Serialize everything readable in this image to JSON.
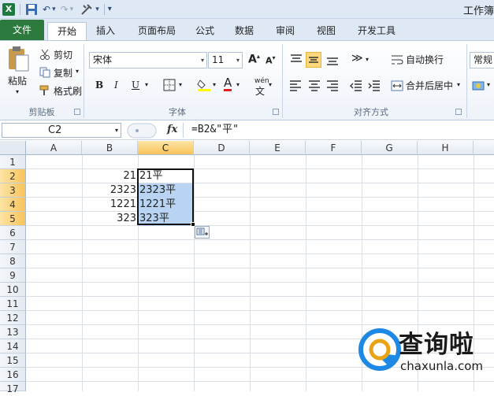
{
  "window": {
    "title": "工作簿"
  },
  "quick_access": {
    "undo": "↶",
    "redo": "↷",
    "customize": "▾"
  },
  "tabs": [
    {
      "label": "文件"
    },
    {
      "label": "开始"
    },
    {
      "label": "插入"
    },
    {
      "label": "页面布局"
    },
    {
      "label": "公式"
    },
    {
      "label": "数据"
    },
    {
      "label": "审阅"
    },
    {
      "label": "视图"
    },
    {
      "label": "开发工具"
    }
  ],
  "ribbon": {
    "clipboard": {
      "paste": "粘贴",
      "cut": "剪切",
      "copy": "复制",
      "format_painter": "格式刷",
      "label": "剪贴板"
    },
    "font": {
      "name": "宋体",
      "size": "11",
      "bold": "B",
      "italic": "I",
      "underline": "U",
      "wen": "wén",
      "label": "字体"
    },
    "alignment": {
      "wrap_text": "自动换行",
      "merge_center": "合并后居中",
      "label": "对齐方式"
    },
    "number": {
      "format": "常规"
    }
  },
  "formula_bar": {
    "name_box": "C2",
    "fx": "fx",
    "formula": "=B2&\"平\""
  },
  "grid": {
    "columns": [
      "A",
      "B",
      "C",
      "D",
      "E",
      "F",
      "G",
      "H"
    ],
    "selected_column": "C",
    "rows": [
      "1",
      "2",
      "3",
      "4",
      "5",
      "6",
      "7",
      "8",
      "9",
      "10",
      "11",
      "12",
      "13",
      "14",
      "15",
      "16",
      "17"
    ],
    "column_b": [
      "21",
      "2323",
      "1221",
      "323"
    ],
    "column_c": [
      "21平",
      "2323平",
      "1221平",
      "323平"
    ]
  },
  "watermark": {
    "text": "查询啦",
    "url": "chaxunla.com"
  },
  "colors": {
    "file_tab": "#2c7a3e",
    "selection": "#b8d4f2",
    "header_selected": "#f8c35a",
    "watermark_blue": "#1e88e5"
  }
}
